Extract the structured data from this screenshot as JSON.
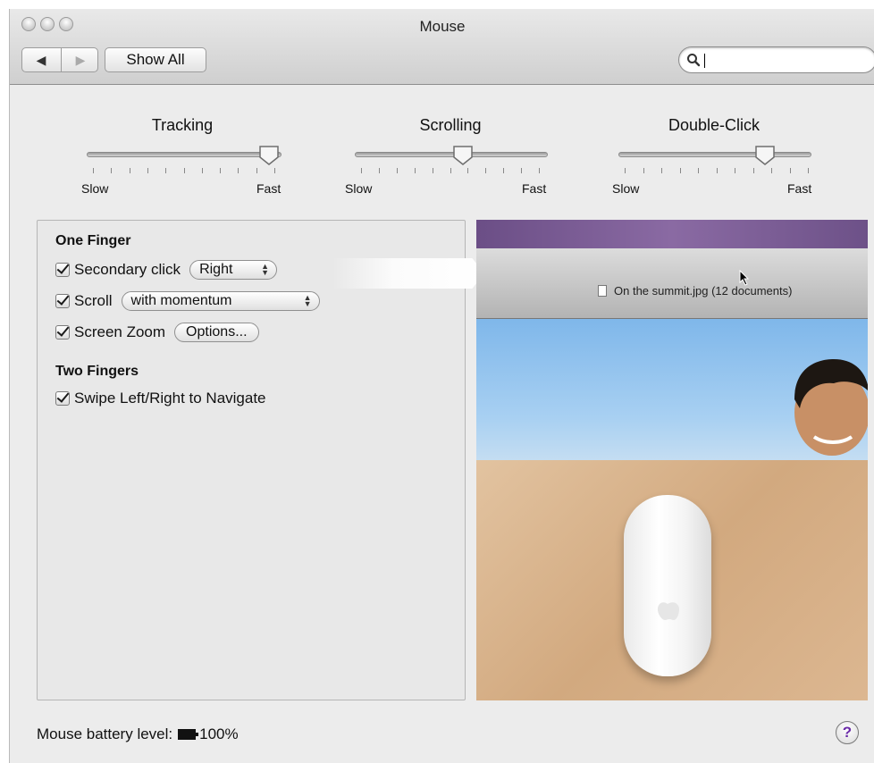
{
  "window": {
    "title": "Mouse"
  },
  "toolbar": {
    "back_glyph": "◀",
    "forward_glyph": "▶",
    "show_all_label": "Show All",
    "search_value": "",
    "search_icon": "magnifier-icon"
  },
  "sliders": [
    {
      "label": "Tracking",
      "min_label": "Slow",
      "max_label": "Fast",
      "value": 0.9
    },
    {
      "label": "Scrolling",
      "min_label": "Slow",
      "max_label": "Fast",
      "value": 0.57
    },
    {
      "label": "Double-Click",
      "min_label": "Slow",
      "max_label": "Fast",
      "value": 0.76
    }
  ],
  "one_finger": {
    "heading": "One Finger",
    "secondary_click": {
      "label": "Secondary click",
      "checked": true,
      "value": "Right"
    },
    "scroll": {
      "label": "Scroll",
      "checked": true,
      "value": "with momentum"
    },
    "screen_zoom": {
      "label": "Screen Zoom",
      "checked": true,
      "button": "Options..."
    }
  },
  "two_fingers": {
    "heading": "Two Fingers",
    "swipe": {
      "label": "Swipe Left/Right to Navigate",
      "checked": true
    }
  },
  "preview": {
    "document_title": "On the summit.jpg (12 documents)"
  },
  "status": {
    "battery_label": "Mouse battery level:",
    "battery_value": "100%"
  },
  "help": {
    "glyph": "?"
  },
  "colors": {
    "window_bg": "#ececec",
    "help_accent": "#6a2aa8"
  }
}
